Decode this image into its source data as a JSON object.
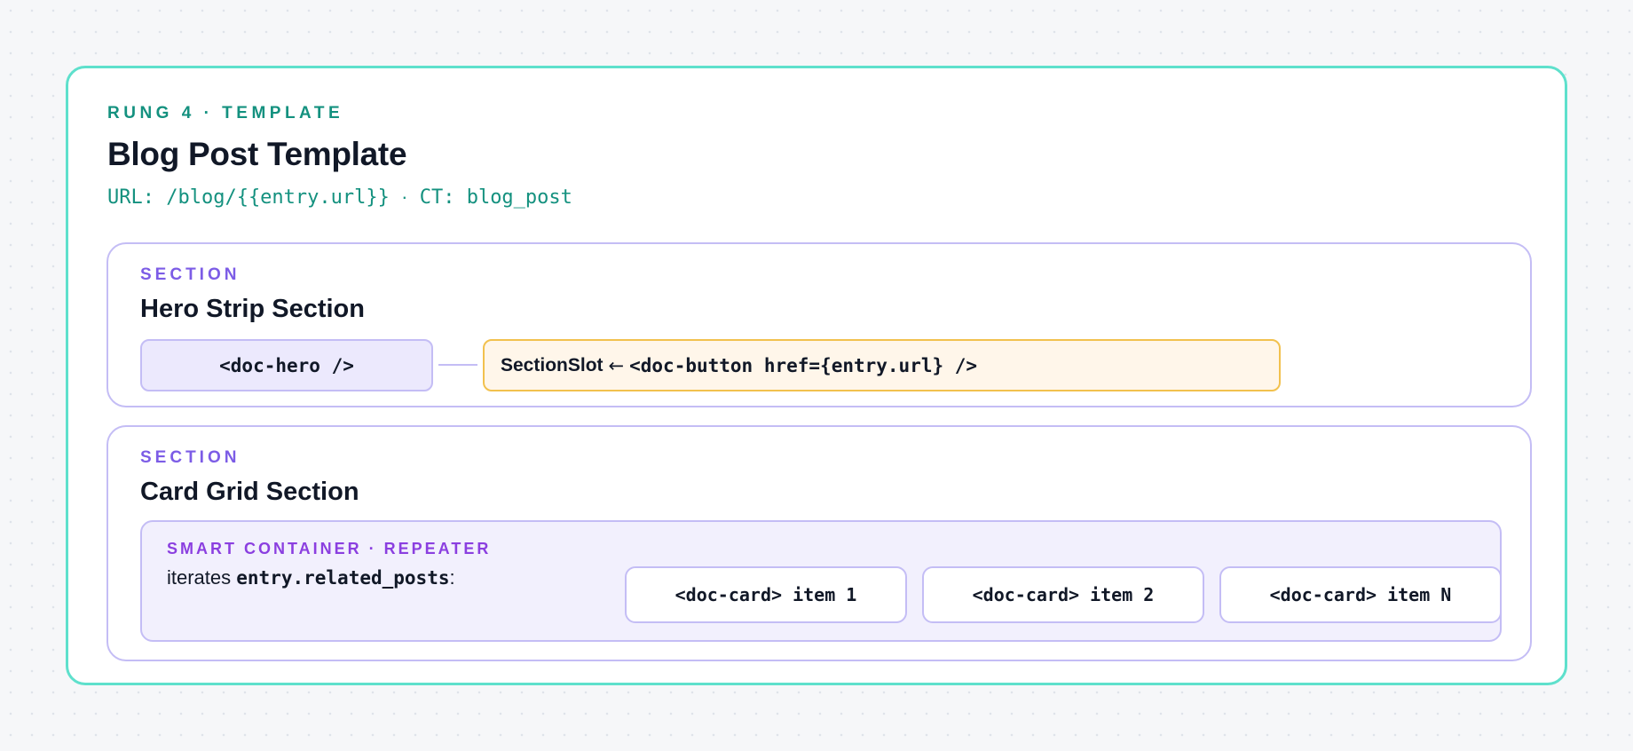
{
  "template": {
    "eyebrow": "RUNG 4 · TEMPLATE",
    "title": "Blog Post Template",
    "url": "URL: /blog/{{entry.url}}",
    "separator": "·",
    "content_type": "CT: blog_post"
  },
  "sections": [
    {
      "label": "SECTION",
      "title": "Hero Strip Section",
      "component": "<doc-hero />",
      "slot": {
        "name": "SectionSlot",
        "arrow": "←",
        "code": "<doc-button href={entry.url} />"
      }
    },
    {
      "label": "SECTION",
      "title": "Card Grid Section",
      "repeater": {
        "label": "SMART CONTAINER · REPEATER",
        "desc_prefix": "iterates ",
        "desc_code": "entry.related_posts",
        "desc_suffix": ":",
        "cards": [
          "<doc-card> item 1",
          "<doc-card> item 2",
          "<doc-card> item N"
        ]
      }
    }
  ],
  "colors": {
    "teal_border": "#5ee0cc",
    "teal_text": "#14917f",
    "purple_border": "#c4bdf5",
    "purple_text": "#7c5ce6",
    "slot_border": "#f2c14e",
    "slot_fill": "#fff6ea"
  }
}
